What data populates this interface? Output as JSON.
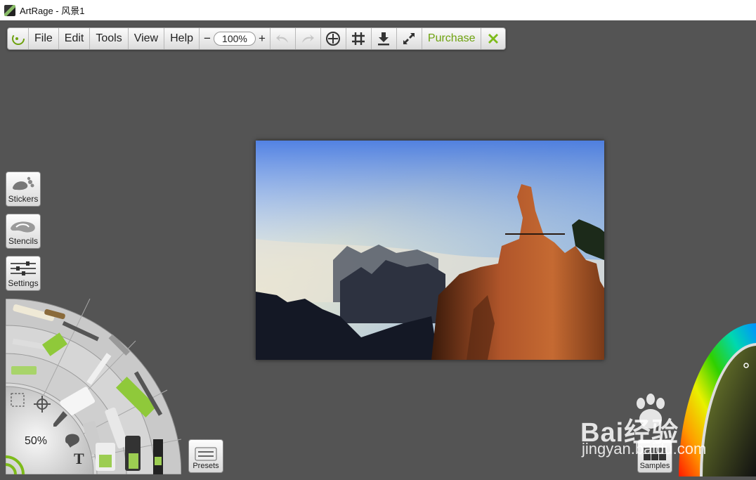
{
  "window": {
    "title": "ArtRage - 风景1"
  },
  "toolbar": {
    "menu": [
      "File",
      "Edit",
      "Tools",
      "View",
      "Help"
    ],
    "zoom_minus": "−",
    "zoom_value": "100%",
    "zoom_plus": "+",
    "purchase_label": "Purchase"
  },
  "side_panels": {
    "stickers": "Stickers",
    "stencils": "Stencils",
    "settings": "Settings"
  },
  "tool_wheel": {
    "brush_size": "50%",
    "text_tool_glyph": "T"
  },
  "bottom_buttons": {
    "presets": "Presets",
    "samples": "Samples"
  },
  "watermark": {
    "main": "Bai经验",
    "sub": "jingyan.baidu.com"
  },
  "colors": {
    "background": "#545454",
    "accent": "#6ea20f"
  }
}
